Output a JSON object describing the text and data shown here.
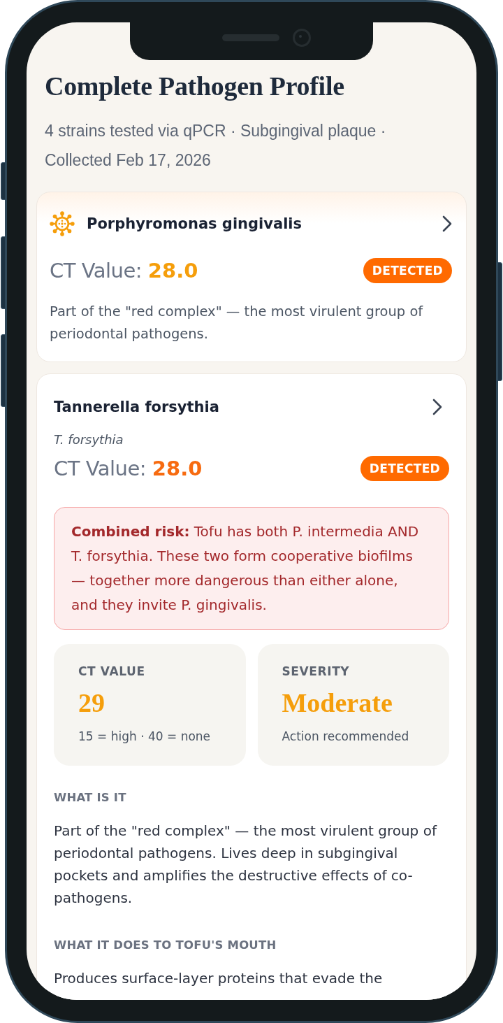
{
  "header": {
    "title": "Complete Pathogen Profile",
    "subtitle": "4 strains tested via qPCR · Subgingival plaque · Collected Feb 17, 2026"
  },
  "pathogens": [
    {
      "kind": "featured",
      "name": "Porphyromonas gingivalis",
      "ct_label": "CT Value:",
      "ct_value": "28.0",
      "color": "#f59e0b",
      "status": "DETECTED",
      "description": "Part of the \"red complex\" — the most virulent group of periodontal pathogens."
    },
    {
      "kind": "detail",
      "name": "Tannerella forsythia",
      "alias": "T. forsythia",
      "ct_label": "CT Value:",
      "ct_value": "28.0",
      "color": "#f76b10",
      "status": "DETECTED",
      "alert": "**Combined risk:** Tofu has both P. intermedia AND T. forsythia. These two form cooperative biofilms — together more dangerous than either alone, and they invite P. gingivalis.",
      "stats": [
        {
          "label": "CT VALUE",
          "value": "29",
          "note": "15 = high · 40 = none"
        },
        {
          "label": "SEVERITY",
          "value": "Moderate",
          "note": "Action recommended"
        }
      ],
      "sections": [
        {
          "heading": "WHAT IS IT",
          "body": "Part of the \"red complex\" — the most virulent group of periodontal pathogens. Lives deep in subgingival pockets and amplifies the destructive effects of co-pathogens."
        },
        {
          "heading": "WHAT IT DOES TO TOFU'S MOUTH",
          "body": "Produces surface-layer proteins that evade the"
        }
      ]
    }
  ]
}
